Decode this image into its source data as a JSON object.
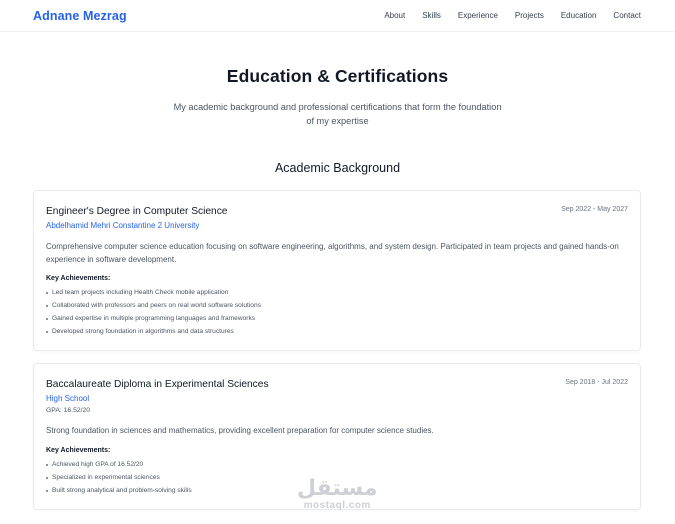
{
  "nav": {
    "brand": "Adnane Mezrag",
    "links": [
      "About",
      "Skills",
      "Experience",
      "Projects",
      "Education",
      "Contact"
    ]
  },
  "hero": {
    "title": "Education & Certifications",
    "subtitle": "My academic background and professional certifications that form the foundation of my expertise"
  },
  "section": {
    "title": "Academic Background"
  },
  "education": [
    {
      "title": "Engineer's Degree in Computer Science",
      "school": "Abdelhamid Mehri Constantine 2 University",
      "date": "Sep 2022 - May 2027",
      "description": "Comprehensive computer science education focusing on software engineering, algorithms, and system design. Participated in team projects and gained hands-on experience in software development.",
      "achievements_heading": "Key Achievements:",
      "achievements": [
        "Led team projects including Health Check mobile application",
        "Collaborated with professors and peers on real world software solutions",
        "Gained expertise in multiple programming languages and frameworks",
        "Developed strong foundation in algorithms and data structures"
      ]
    },
    {
      "title": "Baccalaureate Diploma in Experimental Sciences",
      "school": "High School",
      "gpa": "GPA: 16.52/20",
      "date": "Sep 2018 - Jul 2022",
      "description": "Strong foundation in sciences and mathematics, providing excellent preparation for computer science studies.",
      "achievements_heading": "Key Achievements:",
      "achievements": [
        "Achieved high GPA of 16.52/20",
        "Specialized in experimental sciences",
        "Built strong analytical and problem-solving skills"
      ]
    }
  ],
  "watermark": {
    "arabic": "مستقل",
    "latin": "mostaql.com"
  },
  "colors": {
    "accent": "#2563eb",
    "text": "#111827",
    "muted": "#4b5563",
    "border": "#e8eaee"
  }
}
